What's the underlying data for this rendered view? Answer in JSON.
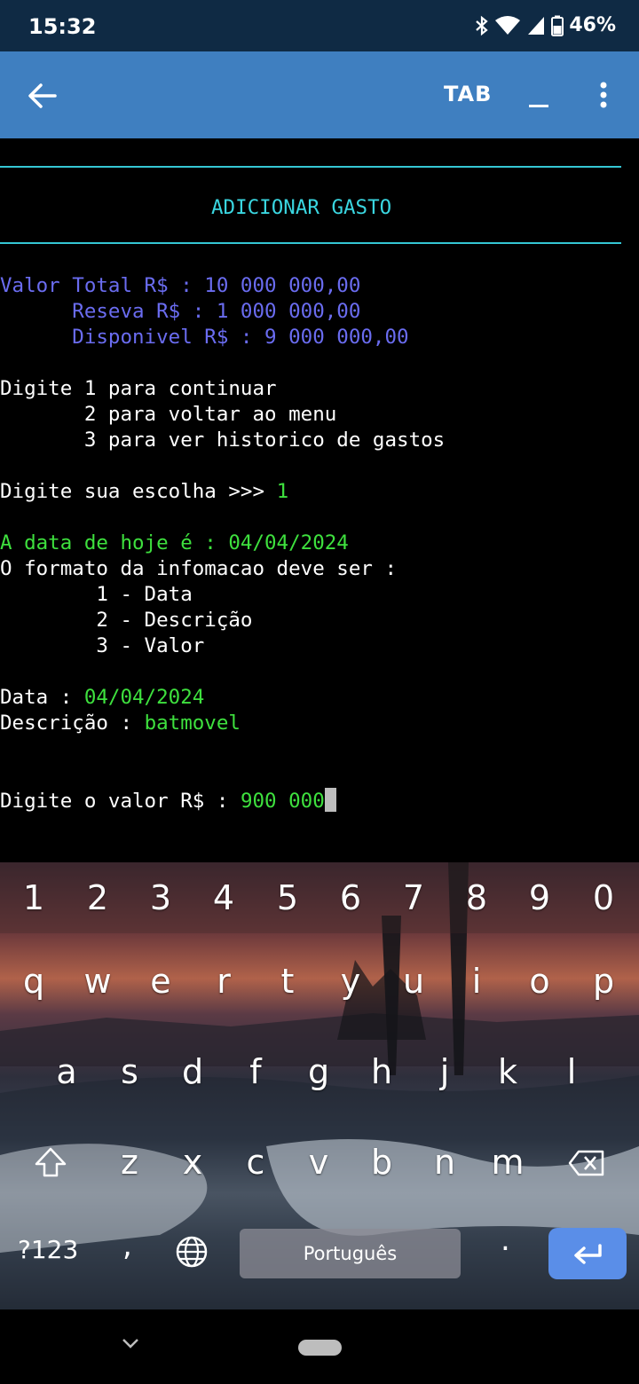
{
  "status_bar": {
    "time": "15:32",
    "battery": "46%"
  },
  "app_bar": {
    "tab_label": "TAB"
  },
  "terminal": {
    "title": "ADICIONAR GASTO",
    "valor_total": "Valor Total R$ : 10 000 000,00",
    "reserva": "      Reseva R$ : 1 000 000,00",
    "disponivel": "      Disponivel R$ : 9 000 000,00",
    "menu_1": "Digite 1 para continuar",
    "menu_2": "       2 para voltar ao menu",
    "menu_3": "       3 para ver historico de gastos",
    "choice_prompt": "Digite sua escolha >>> ",
    "choice_value": "1",
    "date_today": "A data de hoje é : 04/04/2024",
    "format_label": "O formato da infomacao deve ser :",
    "format_1": "        1 - Data",
    "format_2": "        2 - Descrição",
    "format_3": "        3 - Valor",
    "data_label": "Data : ",
    "data_value": "04/04/2024",
    "desc_label": "Descrição : ",
    "desc_value": "batmovel",
    "valor_prompt": "Digite o valor R$ : ",
    "valor_value": "900 000"
  },
  "keyboard": {
    "numbers": [
      "1",
      "2",
      "3",
      "4",
      "5",
      "6",
      "7",
      "8",
      "9",
      "0"
    ],
    "row1": [
      "q",
      "w",
      "e",
      "r",
      "t",
      "y",
      "u",
      "i",
      "o",
      "p"
    ],
    "row2": [
      "a",
      "s",
      "d",
      "f",
      "g",
      "h",
      "j",
      "k",
      "l"
    ],
    "row3": [
      "z",
      "x",
      "c",
      "v",
      "b",
      "n",
      "m"
    ],
    "symbols_key": "?123",
    "comma_key": ",",
    "space_label": "Português",
    "period_key": "."
  }
}
